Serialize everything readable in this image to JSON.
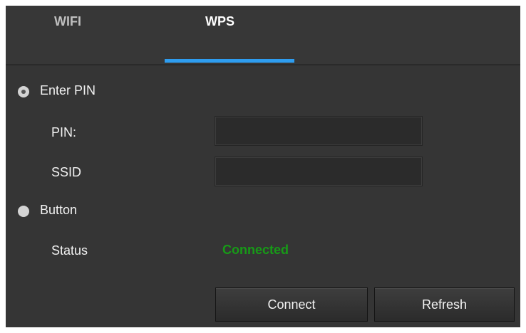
{
  "tabs": [
    {
      "label": "WIFI",
      "active": false
    },
    {
      "label": "WPS",
      "active": true
    }
  ],
  "wps": {
    "mode_pin_label": "Enter PIN",
    "mode_pin_selected": true,
    "pin_label": "PIN:",
    "pin_value": "",
    "ssid_label": "SSID",
    "ssid_value": "",
    "mode_button_label": "Button",
    "mode_button_selected": false,
    "status_label": "Status",
    "status_value": "Connected",
    "status_color": "#179a17"
  },
  "actions": {
    "connect_label": "Connect",
    "refresh_label": "Refresh"
  },
  "colors": {
    "panel_bg": "#353535",
    "accent": "#2e9df0",
    "text": "#f2f2f2"
  }
}
